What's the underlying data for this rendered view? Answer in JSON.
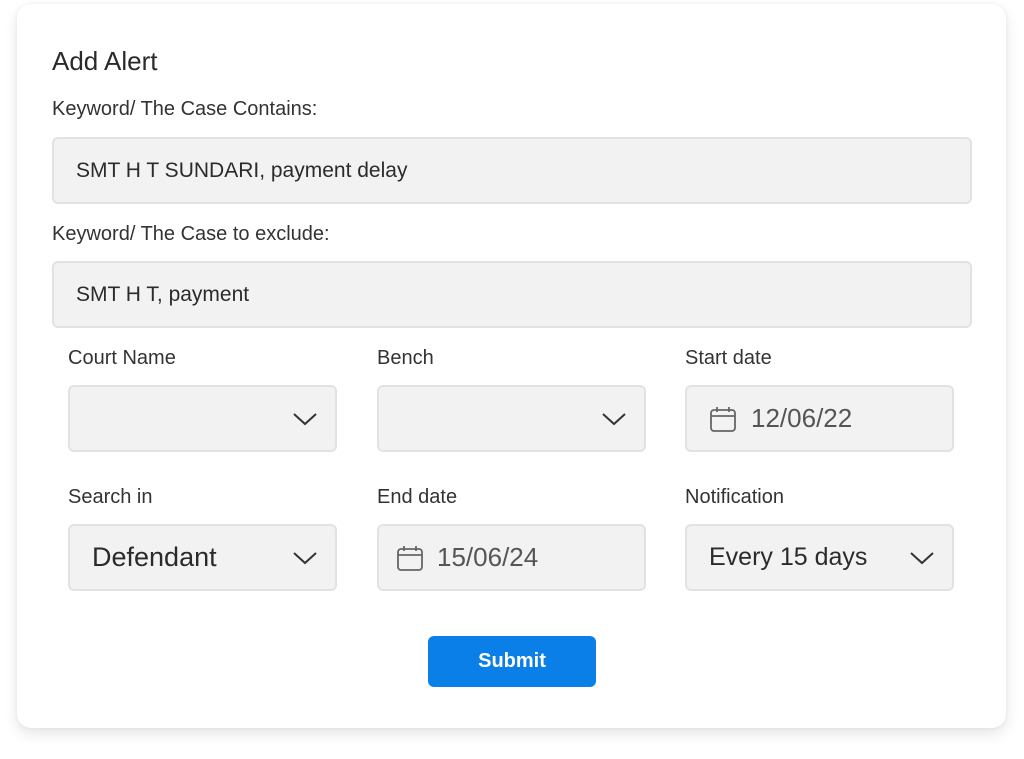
{
  "form": {
    "title": "Add Alert",
    "contains": {
      "label": "Keyword/ The Case Contains:",
      "value": "SMT H T SUNDARI, payment delay"
    },
    "exclude": {
      "label": "Keyword/ The Case to exclude:",
      "value": "SMT H T, payment"
    },
    "court_name": {
      "label": "Court Name",
      "value": "",
      "icon": "chevron-down-icon"
    },
    "bench": {
      "label": "Bench",
      "value": "",
      "icon": "chevron-down-icon"
    },
    "start_date": {
      "label": "Start date",
      "value": "12/06/22",
      "icon": "calendar-icon"
    },
    "search_in": {
      "label": "Search in",
      "value": "Defendant",
      "icon": "chevron-down-icon"
    },
    "end_date": {
      "label": "End date",
      "value": "15/06/24",
      "icon": "calendar-icon"
    },
    "notification": {
      "label": "Notification",
      "value": "Every 15 days",
      "icon": "chevron-down-icon"
    },
    "submit_label": "Submit"
  },
  "colors": {
    "accent": "#0b7fe8",
    "field_bg": "#f2f2f2",
    "field_border": "#e2e2e2"
  }
}
